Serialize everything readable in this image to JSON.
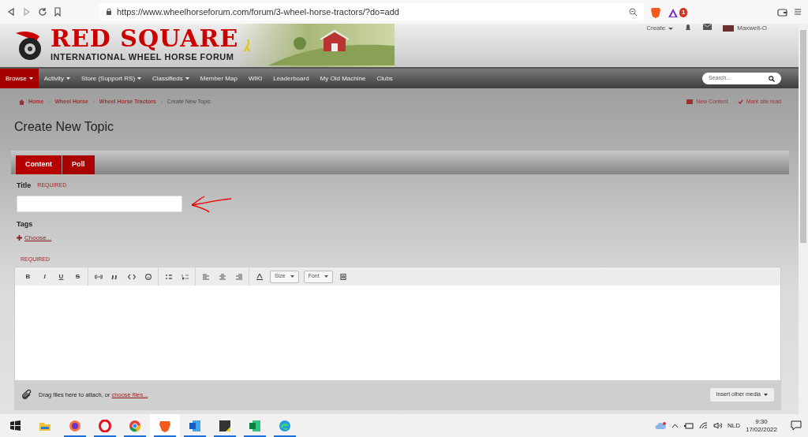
{
  "browser": {
    "url": "https://www.wheelhorseforum.com/forum/3-wheel-horse-tractors/?do=add",
    "alert_badge": "1"
  },
  "header": {
    "logo_title": "RED SQUARE",
    "logo_subtitle": "INTERNATIONAL WHEEL HORSE FORUM",
    "create_label": "Create",
    "user_name": "Maxwell-O"
  },
  "nav": [
    {
      "label": "Browse",
      "has_menu": true,
      "selected": true
    },
    {
      "label": "Activity",
      "has_menu": true,
      "selected": false
    },
    {
      "label": "Store (Support RS)",
      "has_menu": true,
      "selected": false
    },
    {
      "label": "Classifieds",
      "has_menu": true,
      "selected": false
    },
    {
      "label": "Member Map",
      "has_menu": false,
      "selected": false
    },
    {
      "label": "WIKI",
      "has_menu": false,
      "selected": false
    },
    {
      "label": "Leaderboard",
      "has_menu": false,
      "selected": false
    },
    {
      "label": "My Old Machine",
      "has_menu": false,
      "selected": false
    },
    {
      "label": "Clubs",
      "has_menu": false,
      "selected": false
    }
  ],
  "search": {
    "placeholder": "Search..."
  },
  "breadcrumb": [
    {
      "label": "Home",
      "current": false
    },
    {
      "label": "Wheel Horse",
      "current": false
    },
    {
      "label": "Wheel Horse Tractors",
      "current": false
    },
    {
      "label": "Create New Topic",
      "current": true
    }
  ],
  "page_actions": [
    "New Content",
    "Mark site read"
  ],
  "page_title": "Create New Topic",
  "tabs": [
    {
      "label": "Content",
      "selected": true
    },
    {
      "label": "Poll",
      "selected": false
    }
  ],
  "form": {
    "title_label": "Title",
    "title_required": "REQUIRED",
    "tags_label": "Tags",
    "tags_choose": "Choose...",
    "content_required": "REQUIRED"
  },
  "editor": {
    "format_buttons": [
      "B",
      "I",
      "U",
      "S"
    ],
    "dropdowns": [
      "Size",
      "Font"
    ],
    "attach_text": "Drag files here to attach, or ",
    "attach_link": "choose files...",
    "insert_media": "Insert other media"
  },
  "taskbar": {
    "apps": [
      {
        "kind": "explorer",
        "selected": false,
        "running": false
      },
      {
        "kind": "firefox",
        "selected": false,
        "running": true
      },
      {
        "kind": "opera",
        "selected": false,
        "running": true
      },
      {
        "kind": "chrome",
        "selected": false,
        "running": true
      },
      {
        "kind": "brave",
        "selected": true,
        "running": true
      },
      {
        "kind": "word",
        "selected": false,
        "running": true
      },
      {
        "kind": "sticky",
        "selected": false,
        "running": true
      },
      {
        "kind": "excel",
        "selected": false,
        "running": true
      },
      {
        "kind": "edge",
        "selected": false,
        "running": true
      }
    ],
    "language": "NLD",
    "time": "9:30",
    "date": "17/02/2022"
  }
}
